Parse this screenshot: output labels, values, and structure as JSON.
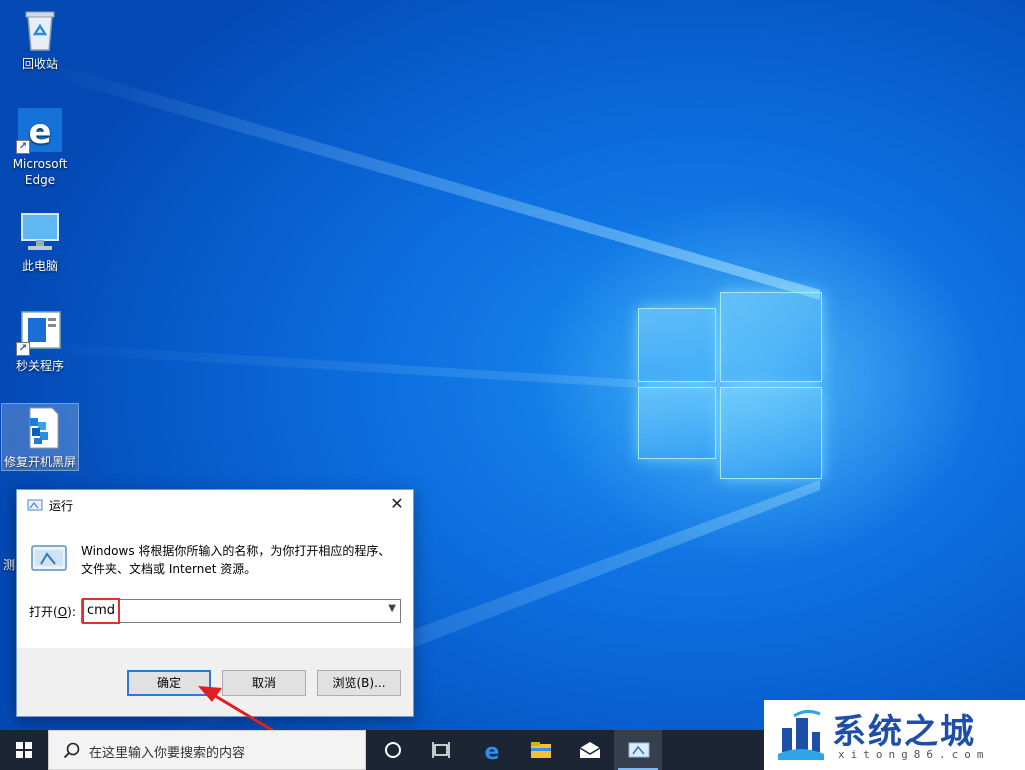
{
  "desktop": {
    "icons": [
      {
        "label": "回收站",
        "icon": "recycle-bin-icon"
      },
      {
        "label": "Microsoft Edge",
        "icon": "edge-icon"
      },
      {
        "label": "此电脑",
        "icon": "computer-icon"
      },
      {
        "label": "秒关程序",
        "icon": "app-window-icon"
      },
      {
        "label": "修复开机黑屏",
        "icon": "repair-cube-icon"
      }
    ],
    "partial_label": "测"
  },
  "run_dialog": {
    "title": "运行",
    "description": "Windows 将根据你所输入的名称，为你打开相应的程序、文件夹、文档或 Internet 资源。",
    "open_label_prefix": "打开(",
    "open_label_key": "O",
    "open_label_suffix": "):",
    "open_value": "cmd",
    "ok_label": "确定",
    "cancel_label": "取消",
    "browse_label": "浏览(B)..."
  },
  "taskbar": {
    "search_placeholder": "在这里输入你要搜索的内容",
    "items": [
      "start-icon",
      "cortana-icon",
      "task-view-icon",
      "edge-icon",
      "file-explorer-icon",
      "mail-icon",
      "run-icon"
    ]
  },
  "watermark": {
    "title": "系统之城",
    "subtitle": "xitong86.com"
  },
  "colors": {
    "wallpaper": "#0a66d6",
    "taskbar": "#1b2533",
    "highlight_red": "#e03030",
    "watermark_blue": "#1d4fa8"
  }
}
